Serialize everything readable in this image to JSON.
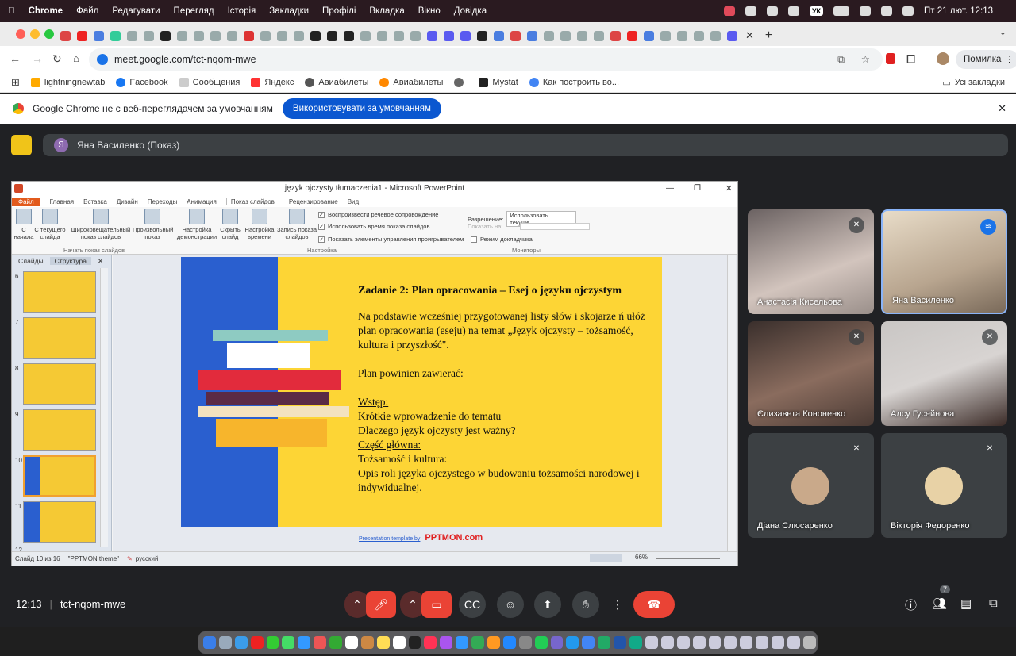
{
  "menubar": {
    "app": "Chrome",
    "items": [
      "Файл",
      "Редагувати",
      "Перегляд",
      "Історія",
      "Закладки",
      "Профілі",
      "Вкладка",
      "Вікно",
      "Довідка"
    ],
    "keyboard": "УК",
    "datetime": "Пт 21 лют.  12:13"
  },
  "browser": {
    "url": "meet.google.com/tct-nqom-mwe",
    "profile_label": "Помилка",
    "bookmarks": [
      "lightningnewtab",
      "Facebook",
      "Сообщения",
      "Яндекс",
      "Авиабилеты",
      "Авиабилеты",
      "",
      "Mystat",
      "Как построить во..."
    ],
    "all_bookmarks": "Усі закладки",
    "infobar": {
      "message": "Google Chrome не є веб-переглядачем за умовчанням",
      "button": "Використовувати за умовчанням"
    }
  },
  "meet": {
    "presenter_label": "Яна Василенко (Показ)",
    "presenter_initial": "Я",
    "time": "12:13",
    "meeting_code": "tct-nqom-mwe",
    "participant_count": "7",
    "participants": [
      {
        "name": "Анастасія Кисельова",
        "muted": true
      },
      {
        "name": "Яна Василенко",
        "muted": false,
        "speaking": true
      },
      {
        "name": "Єлизавета Кононенко",
        "muted": true
      },
      {
        "name": "Алсу Гусейнова",
        "muted": true
      },
      {
        "name": "Діана Слюсаренко",
        "muted": true
      },
      {
        "name": "Вікторія Федоренко",
        "muted": true
      }
    ]
  },
  "ppt": {
    "title": "język ojczysty tłumaczenia1 - Microsoft PowerPoint",
    "tabs": [
      "Файл",
      "Главная",
      "Вставка",
      "Дизайн",
      "Переходы",
      "Анимация",
      "Показ слайдов",
      "Рецензирование",
      "Вид"
    ],
    "ribbon_buttons": [
      "С начала",
      "С текущего слайда",
      "Широковещательный показ слайдов",
      "Произвольный показ",
      "Настройка демонстрации",
      "Скрыть слайд",
      "Настройка времени",
      "Запись показа слайдов"
    ],
    "checks": [
      "Воспроизвести речевое сопровождение",
      "Использовать время показа слайдов",
      "Показать элементы управления проигрывателем"
    ],
    "resolution_label": "Разрешение:",
    "resolution_value": "Использовать текуще...",
    "show_on": "Показать на:",
    "presenter_mode": "Режим докладчика",
    "groups": [
      "Начать показ слайдов",
      "Настройка",
      "Мониторы"
    ],
    "pane_tabs": [
      "Слайды",
      "Структура"
    ],
    "slide_numbers": [
      "6",
      "7",
      "8",
      "9",
      "10",
      "11",
      "12"
    ],
    "status": {
      "slide": "Слайд 10 из 16",
      "theme": "\"PPTMON theme\"",
      "lang": "русский",
      "zoom": "66%"
    },
    "footer": "Presentation template by",
    "footer_brand": "PPTMON.com",
    "slide": {
      "heading": "Zadanie 2: Plan opracowania – Esej o języku ojczystym",
      "lines": [
        "Na podstawie wcześniej przygotowanej listy słów i skojarze ń ułóż plan opracowania (eseju) na temat „Język ojczysty – tożsamość, kultura i przyszłość\".",
        "",
        "Plan powinien zawierać:",
        "",
        "Wstęp:",
        "Krótkie wprowadzenie do tematu",
        "Dlaczego język ojczysty jest ważny?",
        "Część główna:",
        "Tożsamość i kultura:",
        "Opis roli języka ojczystego w budowaniu tożsamości narodowej i indywidualnej."
      ]
    }
  }
}
